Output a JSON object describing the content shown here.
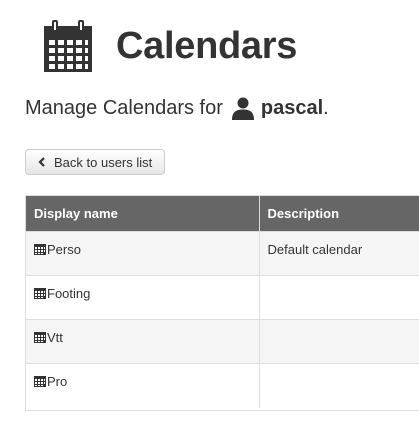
{
  "header": {
    "title": "Calendars",
    "icon": "calendar-icon"
  },
  "subtitle": {
    "prefix": "Manage Calendars for",
    "user_icon": "user-icon",
    "username": "pascal",
    "suffix": "."
  },
  "back_button": {
    "label": "Back to users list",
    "icon": "chevron-left-icon"
  },
  "table": {
    "columns": [
      "Display name",
      "Description"
    ],
    "header_color": "#666666",
    "rows": [
      {
        "name": "Perso",
        "description": "Default calendar"
      },
      {
        "name": "Footing",
        "description": ""
      },
      {
        "name": "Vtt",
        "description": ""
      },
      {
        "name": "Pro",
        "description": ""
      }
    ]
  }
}
